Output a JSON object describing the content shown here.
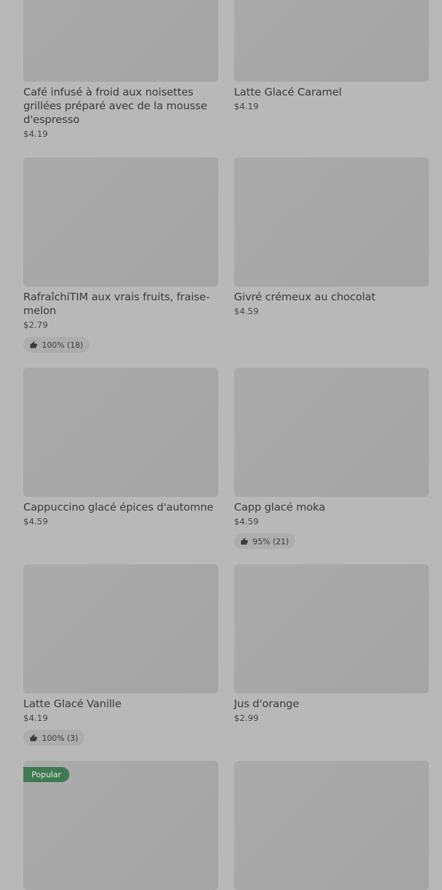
{
  "products": [
    {
      "title": "Café infusé à froid aux noisettes grillées préparé avec de la mousse d'espresso",
      "price": "$4.19"
    },
    {
      "title": "Latte Glacé Caramel",
      "price": "$4.19"
    },
    {
      "title": "RafraîchiTIM aux vrais fruits, fraise-melon",
      "price": "$2.79",
      "rating": "100% (18)"
    },
    {
      "title": "Givré crémeux au chocolat",
      "price": "$4.59"
    },
    {
      "title": "Cappuccino glacé épices d'automne",
      "price": "$4.59"
    },
    {
      "title": "Capp glacé moka",
      "price": "$4.59",
      "rating": "95% (21)"
    },
    {
      "title": "Latte Glacé Vanille",
      "price": "$4.19",
      "rating": "100% (3)"
    },
    {
      "title": "Jus d'orange",
      "price": "$2.99"
    },
    {
      "badge": "Popular"
    },
    {}
  ],
  "icons": {
    "rating": "thumbs-up-icon"
  },
  "colors": {
    "badge": "#3f7a53",
    "overlay": "#b8b8b8"
  }
}
